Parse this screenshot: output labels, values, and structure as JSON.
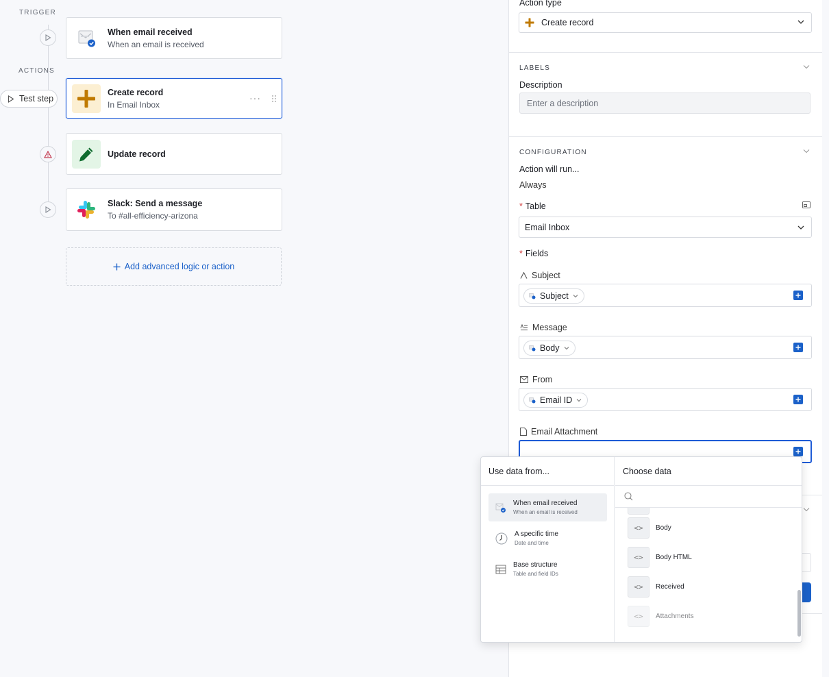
{
  "flow": {
    "trigger_label": "TRIGGER",
    "actions_label": "ACTIONS",
    "test_step_label": "Test step",
    "add_logic_label": "Add advanced logic or action",
    "cards": [
      {
        "title": "When email received",
        "subtitle": "When an email is received",
        "icon": "email-received-icon"
      },
      {
        "title": "Create record",
        "subtitle": "In Email Inbox",
        "icon": "plus-icon",
        "more": "···"
      },
      {
        "title": "Update record",
        "subtitle": "",
        "icon": "pencil-icon"
      },
      {
        "title": "Slack: Send a message",
        "subtitle": "To #all-efficiency-arizona",
        "icon": "slack-icon"
      }
    ]
  },
  "panel": {
    "action_type_label": "Action type",
    "action_type_value": "Create record",
    "labels_section": "LABELS",
    "description_label": "Description",
    "description_placeholder": "Enter a description",
    "configuration_section": "CONFIGURATION",
    "action_will_run_label": "Action will run...",
    "action_will_run_value": "Always",
    "required_mark": "*",
    "table_label": "Table",
    "table_value": "Email Inbox",
    "fields_label": "Fields",
    "fields": [
      {
        "label": "Subject",
        "token": "Subject",
        "icon": "text-a-icon"
      },
      {
        "label": "Message",
        "token": "Body",
        "icon": "long-text-icon"
      },
      {
        "label": "From",
        "token": "Email ID",
        "icon": "envelope-icon"
      },
      {
        "label": "Email Attachment",
        "token": "",
        "icon": "file-icon"
      }
    ]
  },
  "popup": {
    "left_header": "Use data from...",
    "right_header": "Choose data",
    "sources": [
      {
        "title": "When email received",
        "subtitle": "When an email is received"
      },
      {
        "title": "A specific time",
        "subtitle": "Date and time"
      },
      {
        "title": "Base structure",
        "subtitle": "Table and field IDs"
      }
    ],
    "data_items": [
      "Body",
      "Body HTML",
      "Received",
      "Attachments"
    ],
    "code_glyph": "<>"
  },
  "colors": {
    "accent_blue": "#1b61c9",
    "focus_border": "#1e5bd6",
    "create_tile_bg": "#fcefd2",
    "create_plus": "#c07a00",
    "update_tile_bg": "#e3f5e6",
    "update_pencil": "#0e6b2d",
    "warning_red": "#c43d52"
  }
}
